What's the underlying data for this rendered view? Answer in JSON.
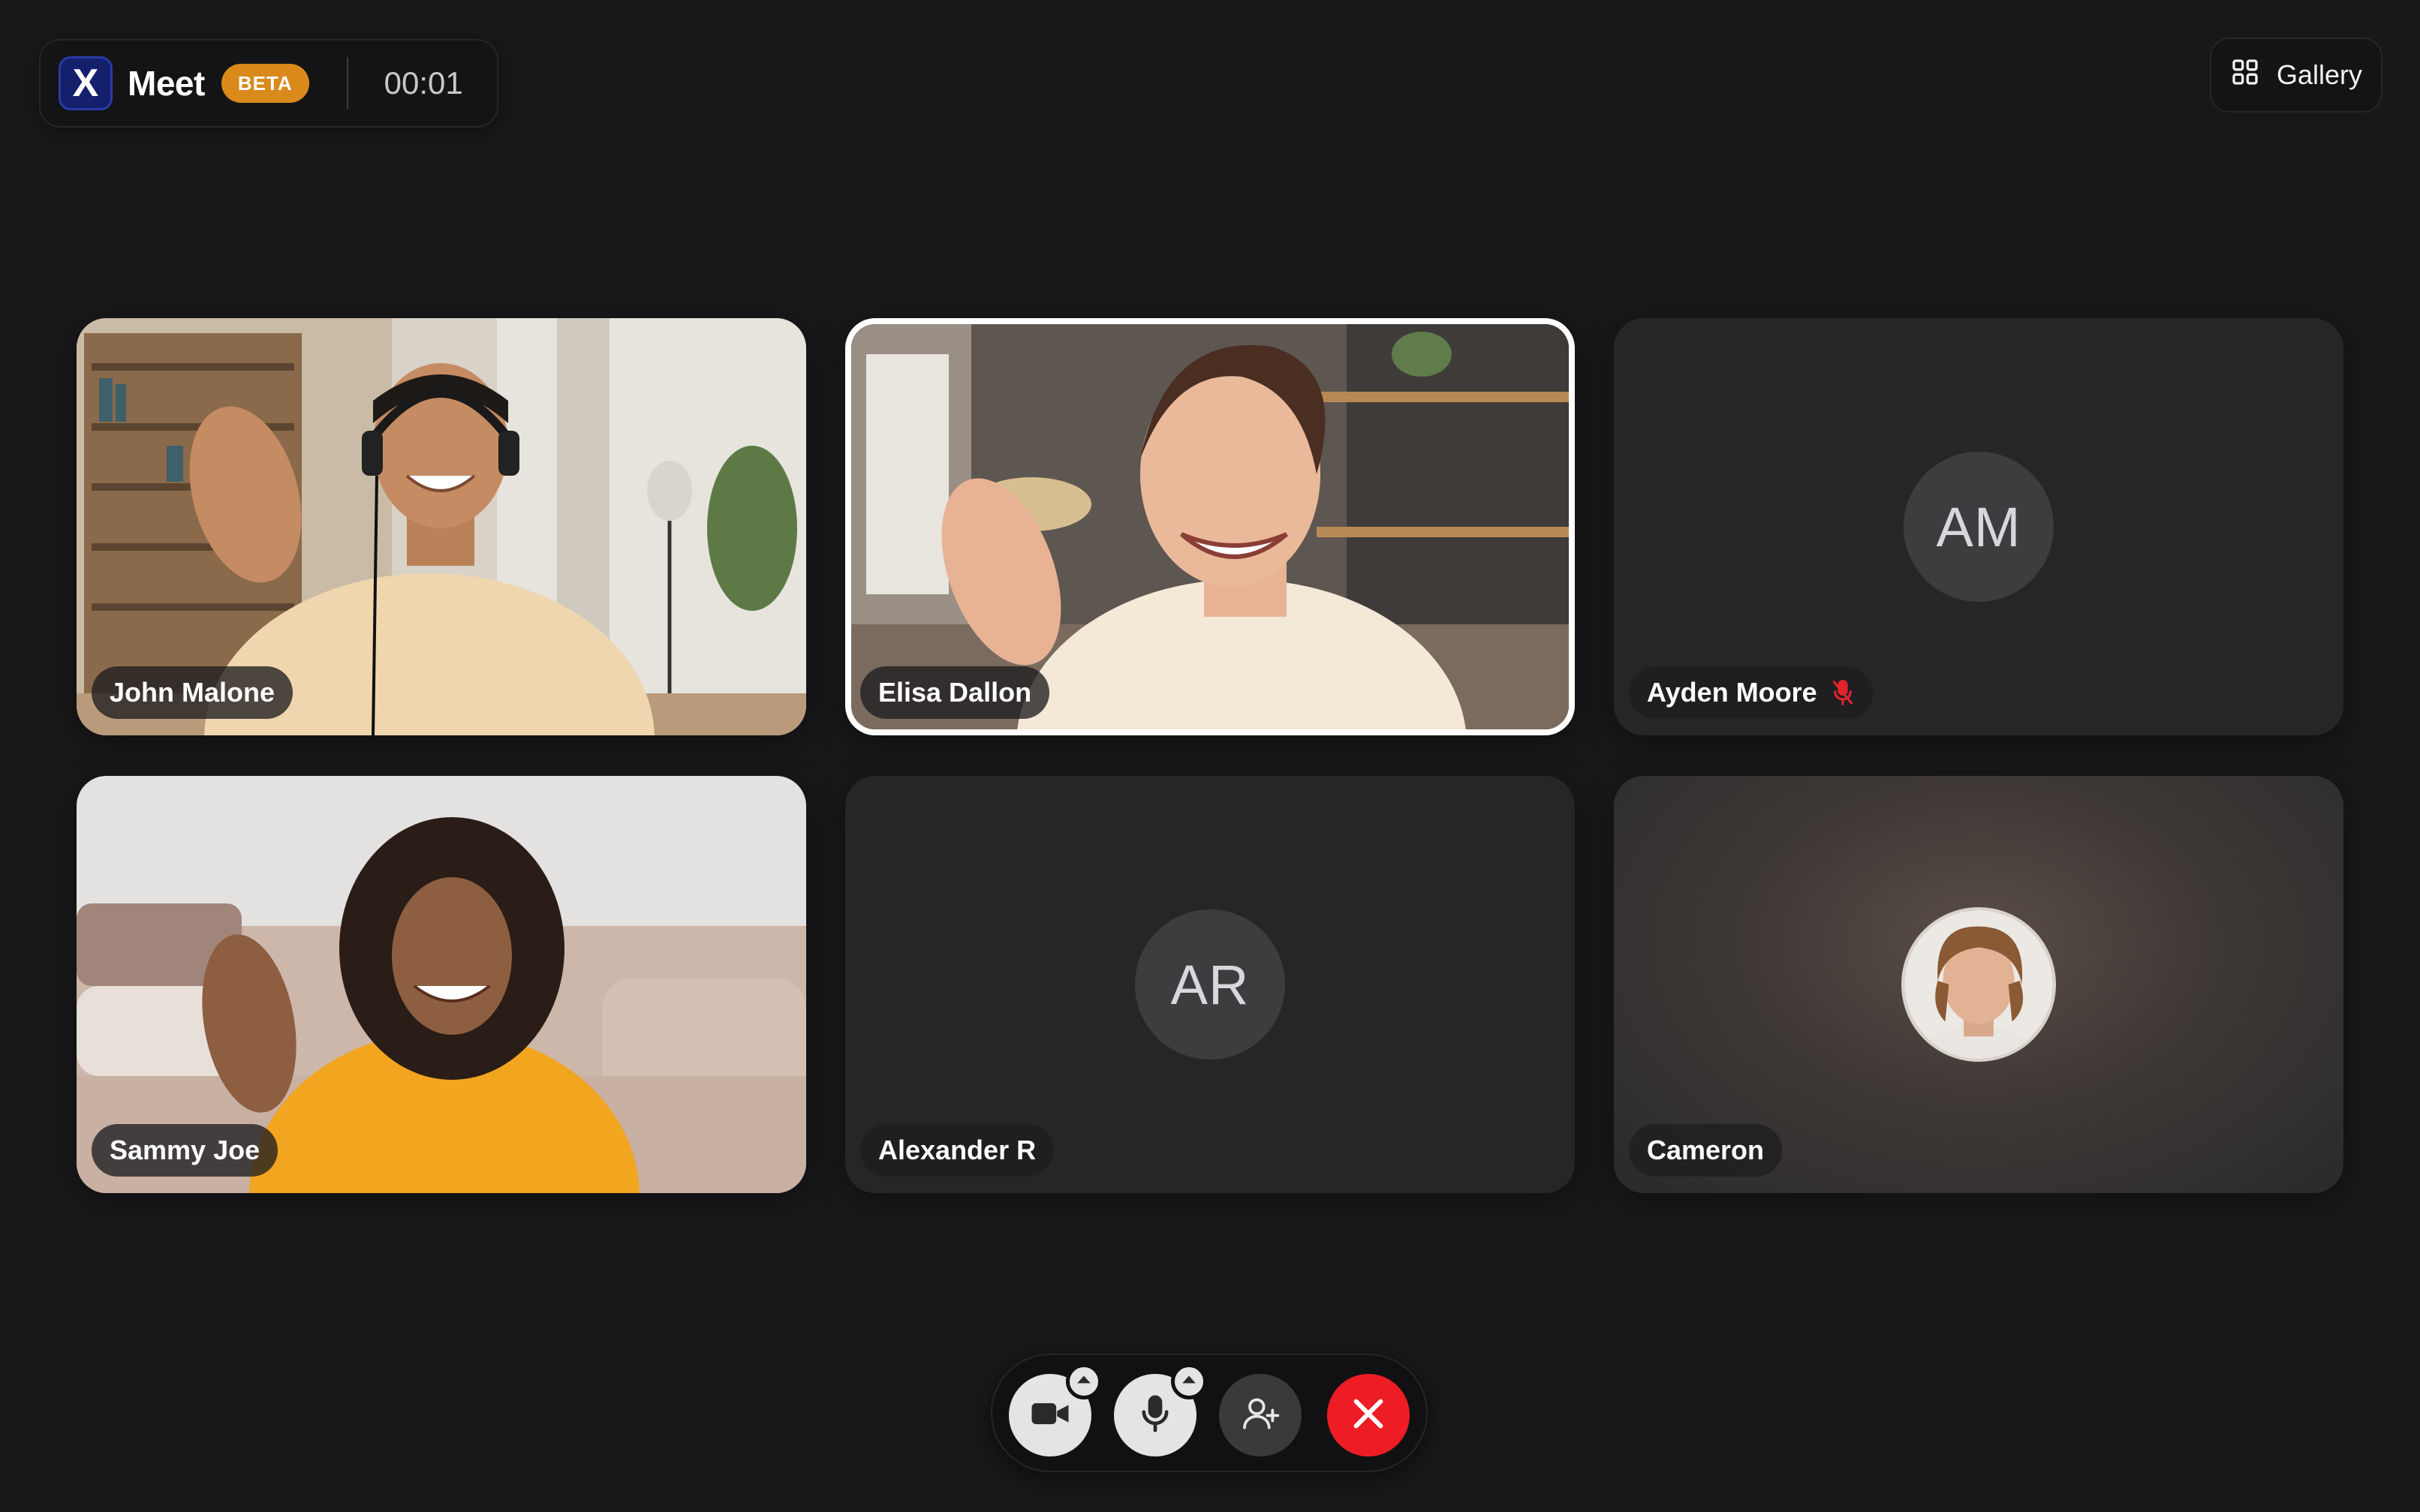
{
  "header": {
    "logo_letter": "X",
    "app_name": "Meet",
    "badge": "BETA",
    "timer": "00:01"
  },
  "view_switch": {
    "label": "Gallery",
    "icon": "grid-icon"
  },
  "participants": [
    {
      "name": "John Malone",
      "video": true
    },
    {
      "name": "Elisa Dallon",
      "video": true,
      "active_speaker": true
    },
    {
      "name": "Ayden Moore",
      "initials": "AM",
      "video": false,
      "muted": true
    },
    {
      "name": "Sammy Joe",
      "video": true
    },
    {
      "name": "Alexander R",
      "initials": "AR",
      "video": false
    },
    {
      "name": "Cameron",
      "video": false,
      "photo_avatar": true
    }
  ],
  "controls": [
    {
      "name": "camera",
      "icon": "camera-icon",
      "has_menu": true
    },
    {
      "name": "microphone",
      "icon": "microphone-icon",
      "has_menu": true
    },
    {
      "name": "add-participant",
      "icon": "add-user-icon"
    },
    {
      "name": "end-call",
      "icon": "close-icon",
      "color": "#ee1d25"
    }
  ],
  "colors": {
    "background": "#18181a",
    "badge": "#d98a1b",
    "end_call": "#ee1d25",
    "muted_icon": "#e0242c"
  }
}
